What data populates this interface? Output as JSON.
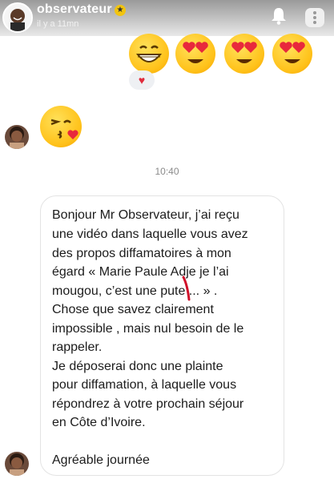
{
  "header": {
    "username": "observateur",
    "star_icon": "star-icon",
    "time_ago": "il y a 11mn",
    "bell_icon": "bell-icon",
    "more_icon": "more-icon"
  },
  "reactions": {
    "emojis": [
      "grinning-face-icon",
      "heart-eyes-icon",
      "heart-eyes-icon",
      "heart-eyes-icon"
    ],
    "reaction_badge": "♥",
    "kiss_emoji": "kissing-heart-icon"
  },
  "timestamp": "10:40",
  "message": {
    "lines": [
      "Bonjour Mr Observateur, j’ai reçu",
      "une vidéo dans laquelle vous avez",
      "des propos diffamatoires à mon",
      "égard «  Marie Paule Adje je l’ai",
      "mougou, c’est une pute ... » .",
      "Chose que savez clairement",
      "impossible , mais nul besoin de le",
      "rappeler.",
      "Je déposerai donc une plainte",
      "pour diffamation, à laquelle vous",
      "répondrez à votre prochain séjour",
      "en Côte d’Ivoire.",
      "Agréable journée"
    ]
  }
}
